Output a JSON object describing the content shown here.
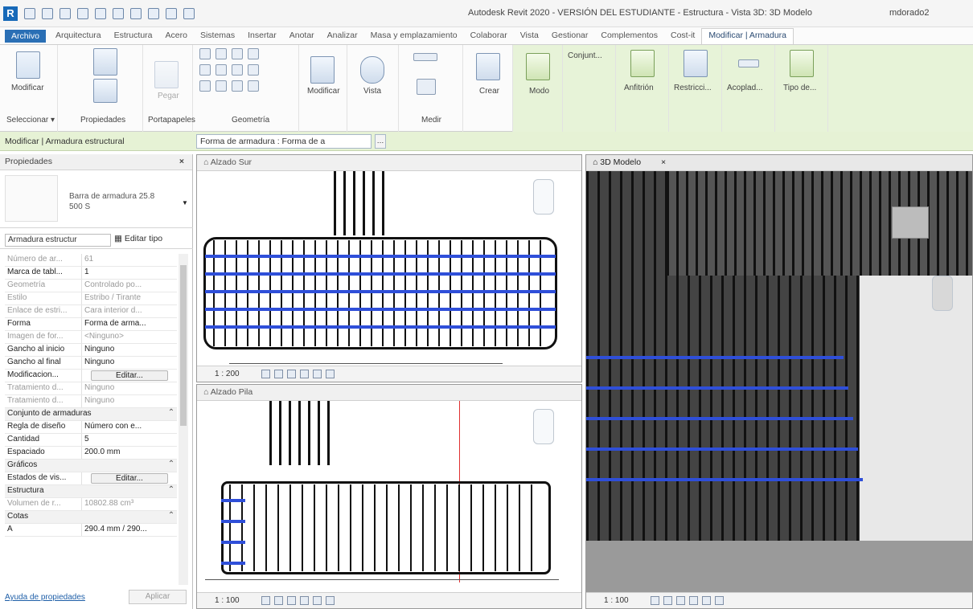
{
  "app": {
    "title": "Autodesk Revit 2020 - VERSIÓN DEL ESTUDIANTE - Estructura - Vista 3D: 3D Modelo",
    "user": "mdorado2"
  },
  "tabs": [
    "Archivo",
    "Arquitectura",
    "Estructura",
    "Acero",
    "Sistemas",
    "Insertar",
    "Anotar",
    "Analizar",
    "Masa y emplazamiento",
    "Colaborar",
    "Vista",
    "Gestionar",
    "Complementos",
    "Cost-it",
    "Modificar | Armadura"
  ],
  "ribbon": {
    "modificar": "Modificar",
    "pegar": "Pegar",
    "modificar2": "Modificar",
    "vista": "Vista",
    "medir": "Medir",
    "crear": "Crear",
    "modo": "Modo",
    "conjunto": "Conjunt...",
    "anfitrion": "Anfitrión",
    "restricciones": "Restricci...",
    "acoplado": "Acoplad...",
    "tipo": "Tipo de...",
    "panels": {
      "seleccionar": "Seleccionar ▾",
      "propiedades": "Propiedades",
      "portapapeles": "Portapapeles",
      "geometria": "Geometría",
      "medir": "Medir"
    }
  },
  "optionsbar": {
    "context": "Modificar | Armadura estructural",
    "shape": "Forma de armadura : Forma de a"
  },
  "properties": {
    "header": "Propiedades",
    "type_name": "Barra de armadura 25.8 500 S",
    "filter": "Armadura estructur",
    "edit_type": "Editar tipo",
    "rows": [
      {
        "k": "Número de ar...",
        "v": "61",
        "dim": true
      },
      {
        "k": "Marca de tabl...",
        "v": "1",
        "dim": false
      },
      {
        "k": "Geometría",
        "v": "Controlado po...",
        "dim": true
      },
      {
        "k": "Estilo",
        "v": "Estribo / Tirante",
        "dim": true
      },
      {
        "k": "Enlace de estri...",
        "v": "Cara interior d...",
        "dim": true
      },
      {
        "k": "Forma",
        "v": "Forma de arma...",
        "dim": false
      },
      {
        "k": "Imagen de for...",
        "v": "<Ninguno>",
        "dim": true
      },
      {
        "k": "Gancho al inicio",
        "v": "Ninguno",
        "dim": false
      },
      {
        "k": "Gancho al final",
        "v": "Ninguno",
        "dim": false
      },
      {
        "k": "Modificacion...",
        "v": "Editar...",
        "dim": false,
        "btn": true
      },
      {
        "k": "Tratamiento d...",
        "v": "Ninguno",
        "dim": true
      },
      {
        "k": "Tratamiento d...",
        "v": "Ninguno",
        "dim": true
      }
    ],
    "group1": "Conjunto de armaduras",
    "rows2": [
      {
        "k": "Regla de diseño",
        "v": "Número con e...",
        "dim": false
      },
      {
        "k": "Cantidad",
        "v": "5",
        "dim": false
      },
      {
        "k": "Espaciado",
        "v": "200.0 mm",
        "dim": false
      }
    ],
    "group2": "Gráficos",
    "rows3": [
      {
        "k": "Estados de vis...",
        "v": "Editar...",
        "dim": false,
        "btn": true
      }
    ],
    "group3": "Estructura",
    "rows4": [
      {
        "k": "Volumen de r...",
        "v": "10802.88 cm³",
        "dim": true
      }
    ],
    "group4": "Cotas",
    "rows5": [
      {
        "k": "A",
        "v": "290.4 mm / 290...",
        "dim": false
      }
    ],
    "help": "Ayuda de propiedades",
    "apply": "Aplicar"
  },
  "views": {
    "sur": "Alzado Sur",
    "pila": "Alzado Pila",
    "model": "3D Modelo",
    "scale": "1 : 200",
    "scale2": "1 : 100",
    "scale3": "1 : 100"
  }
}
